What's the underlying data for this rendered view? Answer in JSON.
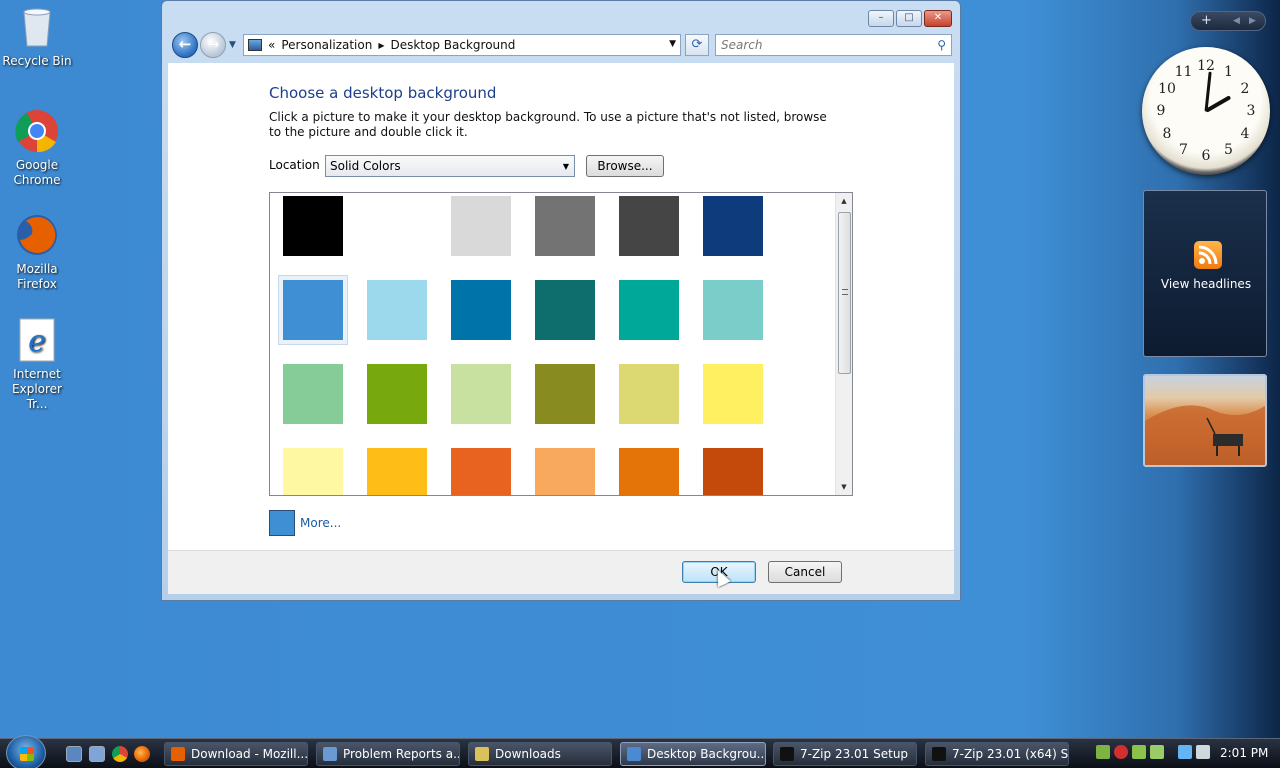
{
  "desktop": {
    "icons": [
      {
        "label": "Recycle Bin",
        "icon": "recycle-bin-icon"
      },
      {
        "label": "Google Chrome",
        "icon": "chrome-icon"
      },
      {
        "label": "Mozilla Firefox",
        "icon": "firefox-icon"
      },
      {
        "label": "Internet Explorer Tr...",
        "icon": "internet-explorer-icon"
      }
    ]
  },
  "gadgets": {
    "bar_add": "+",
    "feeds_label": "View headlines",
    "clock_numbers": [
      "12",
      "1",
      "2",
      "3",
      "4",
      "5",
      "6",
      "7",
      "8",
      "9",
      "10",
      "11"
    ]
  },
  "window": {
    "controls": {
      "minimize": "–",
      "maximize": "□",
      "close": "✕"
    },
    "address": {
      "breadcrumb_prefix": "«",
      "crumbs": [
        "Personalization",
        "Desktop Background"
      ]
    },
    "search_placeholder": "Search",
    "title": "Choose a desktop background",
    "description": "Click a picture to make it your desktop background. To use a picture that's not listed, browse to the picture and double click it.",
    "location_label": "Location",
    "location_value": "Solid Colors",
    "browse_label": "Browse...",
    "swatches": [
      [
        "#000000",
        "#ffffff",
        "#d9d9d9",
        "#737373",
        "#454545",
        "#0d3b7b"
      ],
      [
        "#3f8fd4",
        "#9dd9ed",
        "#0073a8",
        "#0e6d6d",
        "#00a89a",
        "#7acdc8"
      ],
      [
        "#86cc98",
        "#77a80e",
        "#c8e0a0",
        "#888b20",
        "#dcd872",
        "#fff061"
      ],
      [
        "#fff8a3",
        "#ffbe17",
        "#e86220",
        "#f8a95e",
        "#e57408",
        "#c44a0b"
      ]
    ],
    "selected_swatch": "#3f8fd4",
    "more_label": "More...",
    "ok_label": "OK",
    "cancel_label": "Cancel"
  },
  "taskbar": {
    "tasks": [
      {
        "label": "Download - Mozill...",
        "icon_color": "#e66000"
      },
      {
        "label": "Problem Reports a...",
        "icon_color": "#6a9ad1"
      },
      {
        "label": "Downloads",
        "icon_color": "#d9c25a"
      },
      {
        "label": "Desktop Backgrou...",
        "icon_color": "#4a8ad0"
      },
      {
        "label": "7-Zip 23.01 Setup",
        "icon_color": "#111111"
      },
      {
        "label": "7-Zip 23.01 (x64) S...",
        "icon_color": "#111111"
      }
    ],
    "time": "2:01 PM"
  }
}
